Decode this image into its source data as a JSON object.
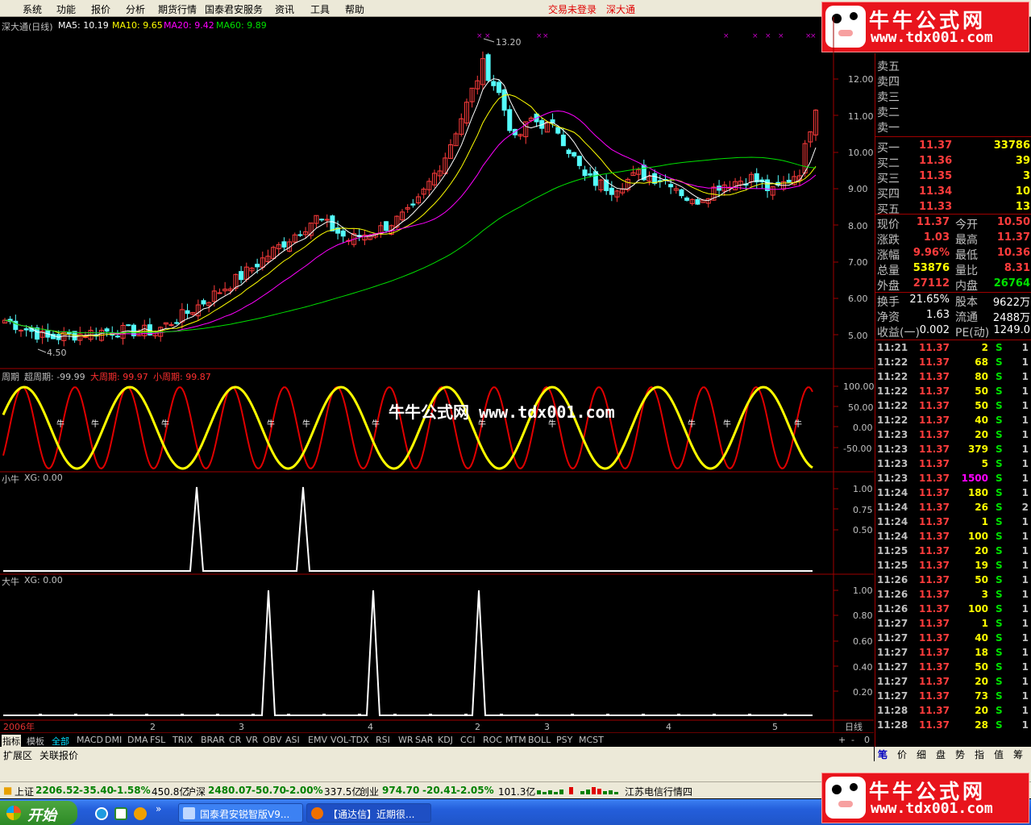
{
  "menu": {
    "items": [
      "系统",
      "功能",
      "报价",
      "分析",
      "期货行情",
      "国泰君安服务",
      "资讯",
      "工具",
      "帮助"
    ],
    "login_status": "交易未登录",
    "site": "深大通"
  },
  "logo": {
    "text1": "牛牛公式网",
    "text2": "www.tdx001.com"
  },
  "main": {
    "title": "深大通(日线)",
    "ma5": "MA5: 10.19",
    "ma10": "MA10: 9.65",
    "ma20": "MA20: 9.42",
    "ma60": "MA60: 9.89",
    "high_label": "13.20",
    "low_label": "4.50",
    "yticks": [
      "12.00",
      "11.00",
      "10.00",
      "9.00",
      "8.00",
      "7.00",
      "6.00",
      "5.00"
    ],
    "colors": {
      "up": "#ff3c3c",
      "down": "#54fcfc",
      "ma5": "#ffffff",
      "ma10": "#ffff00",
      "ma20": "#ff00ff",
      "ma60": "#00e000"
    }
  },
  "cycle": {
    "title": "周期",
    "super": "超周期: -99.99",
    "big": "大周期: 99.97",
    "small": "小周期: 99.87",
    "yticks": [
      "100.00",
      "50.00",
      "0.00",
      "-50.00"
    ],
    "marker": "牛",
    "watermark": "牛牛公式网 www.tdx001.com"
  },
  "small_niu": {
    "title": "小牛",
    "xg": "XG: 0.00",
    "yticks": [
      "1.00",
      "0.75",
      "0.50"
    ]
  },
  "big_niu": {
    "title": "大牛",
    "xg": "XG: 0.00",
    "yticks": [
      "1.00",
      "0.80",
      "0.60",
      "0.40",
      "0.20"
    ]
  },
  "xaxis": {
    "year": "2006年",
    "months": [
      "2",
      "3",
      "4",
      "2",
      "3",
      "4",
      "5"
    ],
    "period": "日线"
  },
  "quote": {
    "sell": [
      "卖五",
      "卖四",
      "卖三",
      "卖二",
      "卖一"
    ],
    "buy": [
      {
        "label": "买一",
        "price": "11.37",
        "vol": "33786"
      },
      {
        "label": "买二",
        "price": "11.36",
        "vol": "39"
      },
      {
        "label": "买三",
        "price": "11.35",
        "vol": "3"
      },
      {
        "label": "买四",
        "price": "11.34",
        "vol": "10"
      },
      {
        "label": "买五",
        "price": "11.33",
        "vol": "13"
      }
    ],
    "stats": [
      {
        "l1": "现价",
        "v1": "11.37",
        "l2": "今开",
        "v2": "10.50"
      },
      {
        "l1": "涨跌",
        "v1": "1.03",
        "l2": "最高",
        "v2": "11.37"
      },
      {
        "l1": "涨幅",
        "v1": "9.96%",
        "l2": "最低",
        "v2": "10.36"
      },
      {
        "l1": "总量",
        "v1": "53876",
        "l2": "量比",
        "v2": "8.31"
      },
      {
        "l1": "外盘",
        "v1": "27112",
        "l2": "内盘",
        "v2": "26764"
      }
    ],
    "fund": [
      {
        "l1": "换手",
        "v1": "21.65%",
        "l2": "股本",
        "v2": "9622万"
      },
      {
        "l1": "净资",
        "v1": "1.63",
        "l2": "流通",
        "v2": "2488万"
      },
      {
        "l1": "收益(一)",
        "v1": "0.002",
        "l2": "PE(动)",
        "v2": "1249.0"
      }
    ]
  },
  "ticks": [
    {
      "t": "11:21",
      "p": "11.37",
      "v": "2",
      "s": "S",
      "n": "1"
    },
    {
      "t": "11:22",
      "p": "11.37",
      "v": "68",
      "s": "S",
      "n": "1"
    },
    {
      "t": "11:22",
      "p": "11.37",
      "v": "80",
      "s": "S",
      "n": "1"
    },
    {
      "t": "11:22",
      "p": "11.37",
      "v": "50",
      "s": "S",
      "n": "1"
    },
    {
      "t": "11:22",
      "p": "11.37",
      "v": "50",
      "s": "S",
      "n": "1"
    },
    {
      "t": "11:22",
      "p": "11.37",
      "v": "40",
      "s": "S",
      "n": "1"
    },
    {
      "t": "11:23",
      "p": "11.37",
      "v": "20",
      "s": "S",
      "n": "1"
    },
    {
      "t": "11:23",
      "p": "11.37",
      "v": "379",
      "s": "S",
      "n": "1"
    },
    {
      "t": "11:23",
      "p": "11.37",
      "v": "5",
      "s": "S",
      "n": "1"
    },
    {
      "t": "11:23",
      "p": "11.37",
      "v": "1500",
      "s": "S",
      "n": "1"
    },
    {
      "t": "11:24",
      "p": "11.37",
      "v": "180",
      "s": "S",
      "n": "1"
    },
    {
      "t": "11:24",
      "p": "11.37",
      "v": "26",
      "s": "S",
      "n": "2"
    },
    {
      "t": "11:24",
      "p": "11.37",
      "v": "1",
      "s": "S",
      "n": "1"
    },
    {
      "t": "11:24",
      "p": "11.37",
      "v": "100",
      "s": "S",
      "n": "1"
    },
    {
      "t": "11:25",
      "p": "11.37",
      "v": "20",
      "s": "S",
      "n": "1"
    },
    {
      "t": "11:25",
      "p": "11.37",
      "v": "19",
      "s": "S",
      "n": "1"
    },
    {
      "t": "11:26",
      "p": "11.37",
      "v": "50",
      "s": "S",
      "n": "1"
    },
    {
      "t": "11:26",
      "p": "11.37",
      "v": "3",
      "s": "S",
      "n": "1"
    },
    {
      "t": "11:26",
      "p": "11.37",
      "v": "100",
      "s": "S",
      "n": "1"
    },
    {
      "t": "11:27",
      "p": "11.37",
      "v": "1",
      "s": "S",
      "n": "1"
    },
    {
      "t": "11:27",
      "p": "11.37",
      "v": "40",
      "s": "S",
      "n": "1"
    },
    {
      "t": "11:27",
      "p": "11.37",
      "v": "18",
      "s": "S",
      "n": "1"
    },
    {
      "t": "11:27",
      "p": "11.37",
      "v": "50",
      "s": "S",
      "n": "1"
    },
    {
      "t": "11:27",
      "p": "11.37",
      "v": "20",
      "s": "S",
      "n": "1"
    },
    {
      "t": "11:27",
      "p": "11.37",
      "v": "73",
      "s": "S",
      "n": "1"
    },
    {
      "t": "11:28",
      "p": "11.37",
      "v": "20",
      "s": "S",
      "n": "1"
    },
    {
      "t": "11:28",
      "p": "11.37",
      "v": "28",
      "s": "S",
      "n": "1"
    }
  ],
  "indicator_tabs": [
    "指标",
    "模板",
    "全部",
    "MACD",
    "DMI",
    "DMA",
    "FSL",
    "TRIX",
    "BRAR",
    "CR",
    "VR",
    "OBV",
    "ASI",
    "EMV",
    "VOL-TDX",
    "RSI",
    "WR",
    "SAR",
    "KDJ",
    "CCI",
    "ROC",
    "MTM",
    "BOLL",
    "PSY",
    "MCST"
  ],
  "zoom_controls": [
    "+",
    "-",
    "0"
  ],
  "ext_tabs": [
    "扩展区",
    "关联报价"
  ],
  "right_tabs": [
    "笔",
    "价",
    "细",
    "盘",
    "势",
    "指",
    "值",
    "筹"
  ],
  "status": {
    "sh_name": "上证",
    "sh_val": "2206.52",
    "sh_chg": "-35.40",
    "sh_pct": "-1.58%",
    "sh_amt": "450.8亿",
    "sz_name": "沪深",
    "sz_val": "2480.07",
    "sz_chg": "-50.70",
    "sz_pct": "-2.00%",
    "sz_amt": "337.5亿",
    "cy_name": "创业",
    "cy_val": "974.70",
    "cy_chg": "-20.41",
    "cy_pct": "-2.05%",
    "cy_amt": "101.3亿",
    "news": "江苏电信行情四"
  },
  "taskbar": {
    "start": "开始",
    "tasks": [
      "国泰君安锐智版V9...",
      "【通达信】近期很..."
    ]
  }
}
